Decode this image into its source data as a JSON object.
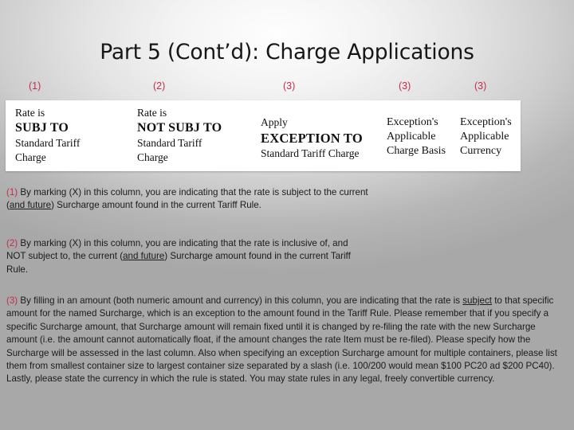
{
  "slide": {
    "title": "Part 5 (Cont’d): Charge Applications",
    "marker_color": "#c0304a",
    "text_color": "#1b1b1b"
  },
  "column_markers": [
    {
      "label": "(1)"
    },
    {
      "label": "(2)"
    },
    {
      "label": "(3)"
    },
    {
      "label": "(3)"
    },
    {
      "label": "(3)"
    }
  ],
  "table_figure": {
    "columns": [
      {
        "line1": "Rate is",
        "line2": "SUBJ TO",
        "line3": "Standard Tariff",
        "line4": "Charge"
      },
      {
        "line1": "Rate is",
        "line2": "NOT SUBJ TO",
        "line3": "Standard Tariff",
        "line4": "Charge"
      },
      {
        "line1": "Apply",
        "line2": "EXCEPTION TO",
        "line3": "Standard Tariff Charge",
        "line4": ""
      },
      {
        "line1": "Exception's",
        "line2": "Applicable",
        "line3": "Charge Basis",
        "line4": ""
      },
      {
        "line1": "Exception's",
        "line2": "Applicable",
        "line3": "Currency",
        "line4": ""
      }
    ]
  },
  "notes": [
    {
      "marker": "(1)",
      "part_a": " By marking (X) in this column, you are indicating that the rate is subject to the current (",
      "underlined": "and future",
      "part_b": ") Surcharge amount found in the current Tariff Rule."
    },
    {
      "marker": "(2)",
      "part_a": " By marking (X) in this column, you are indicating that the rate is inclusive of, and NOT subject to, the current (",
      "underlined": "and future",
      "part_b": ") Surcharge amount found in the current Tariff Rule."
    },
    {
      "marker": "(3)",
      "part_a": " By filling in an amount (both numeric amount and currency) in this column, you are indicating that the rate is ",
      "underlined": "subject",
      "part_b": " to that specific amount for the named Surcharge, which is an exception to the amount found in the Tariff Rule.  Please remember that if you specify a specific Surcharge amount, that Surcharge amount will remain fixed until it is changed by re-filing the rate with the new Surcharge amount (i.e. the amount cannot automatically float, if the amount changes the rate Item must be re-filed).  Please specify how the Surcharge will be assessed in the last column.  Also when specifying an exception Surcharge amount for multiple containers, please list them from smallest container size to largest container size separated by a slash (i.e. 100/200 would mean $100 PC20 ad $200 PC40).  Lastly, please state the currency in which the rule is stated.  You may state rules in any legal, freely convertible currency."
    }
  ]
}
